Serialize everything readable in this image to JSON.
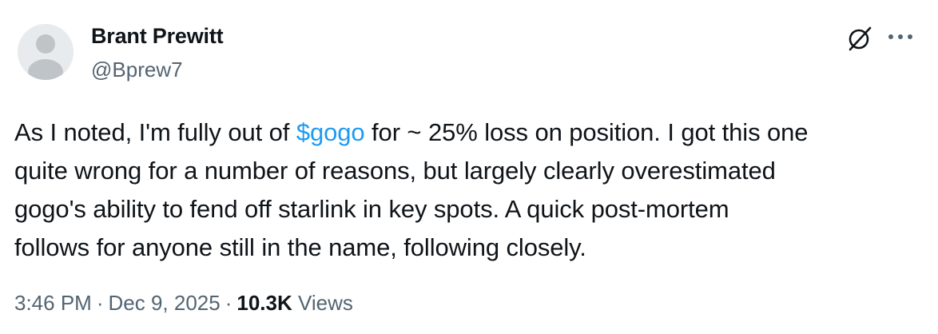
{
  "author": {
    "name": "Brant Prewitt",
    "handle": "@Bprew7"
  },
  "tweet": {
    "line1_before": "As I noted, I'm fully out of ",
    "cashtag": "$gogo",
    "line1_after": " for ~ 25% loss on position. I got this one",
    "line2": "quite wrong for a number of reasons, but largely clearly overestimated",
    "line3": "gogo's ability to fend off starlink in key spots. A quick post-mortem",
    "line4": "follows for anyone still in the name, following closely."
  },
  "meta": {
    "time": "3:46 PM",
    "separator": "·",
    "date": "Dec 9, 2025",
    "views_count": "10.3K",
    "views_label": "Views"
  },
  "icons": {
    "grok": "grok-icon",
    "more": "more-options-icon",
    "avatar": "default-avatar"
  },
  "colors": {
    "link": "#1d9bf0",
    "secondary_text": "#536471",
    "primary_text": "#0f1419"
  }
}
